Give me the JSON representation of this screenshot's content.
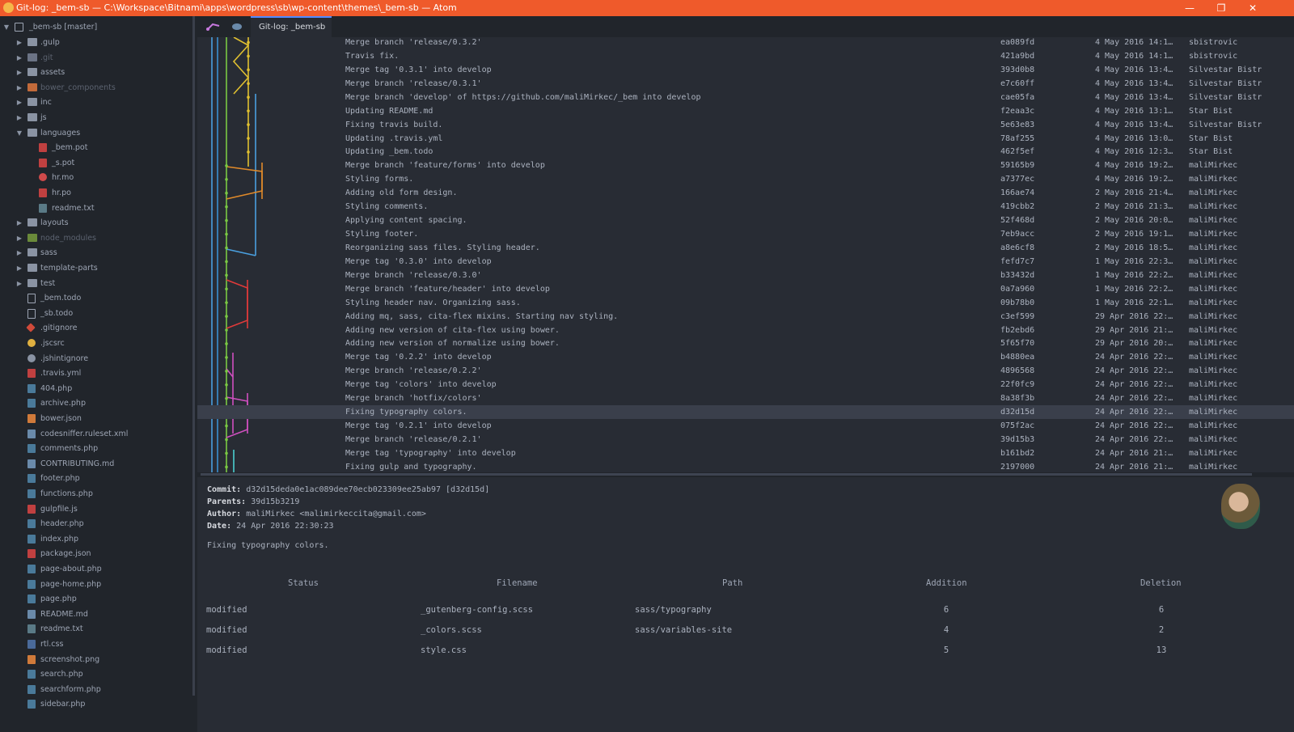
{
  "window": {
    "title": "Git-log: _bem-sb — C:\\Workspace\\Bitnami\\apps\\wordpress\\sb\\wp-content\\themes\\_bem-sb — Atom",
    "min_glyph": "—",
    "max_glyph": "❐",
    "close_glyph": "✕"
  },
  "tree": {
    "root": "_bem-sb [master]",
    "items": [
      {
        "label": ".gulp",
        "type": "folder",
        "depth": 1,
        "expanded": false,
        "color": "#8a93a3"
      },
      {
        "label": ".git",
        "type": "git",
        "depth": 1,
        "expanded": false,
        "color": "#6b7385",
        "dim": true
      },
      {
        "label": "assets",
        "type": "folder",
        "depth": 1,
        "expanded": false,
        "color": "#8a93a3"
      },
      {
        "label": "bower_components",
        "type": "bower",
        "depth": 1,
        "expanded": false,
        "color": "#c26a3a",
        "dim": true
      },
      {
        "label": "inc",
        "type": "folder",
        "depth": 1,
        "expanded": false,
        "color": "#8a93a3"
      },
      {
        "label": "js",
        "type": "folder",
        "depth": 1,
        "expanded": false,
        "color": "#8a93a3"
      },
      {
        "label": "languages",
        "type": "folder",
        "depth": 1,
        "expanded": true,
        "color": "#8a93a3"
      },
      {
        "label": "_bem.pot",
        "type": "file",
        "depth": 2,
        "color": "#c04040"
      },
      {
        "label": "_s.pot",
        "type": "file",
        "depth": 2,
        "color": "#c04040"
      },
      {
        "label": "hr.mo",
        "type": "file",
        "depth": 2,
        "color": "#d04a4a",
        "round": true
      },
      {
        "label": "hr.po",
        "type": "file",
        "depth": 2,
        "color": "#c04040"
      },
      {
        "label": "readme.txt",
        "type": "file",
        "depth": 2,
        "color": "#5a7a86"
      },
      {
        "label": "layouts",
        "type": "folder",
        "depth": 1,
        "expanded": false,
        "color": "#8a93a3"
      },
      {
        "label": "node_modules",
        "type": "node",
        "depth": 1,
        "expanded": false,
        "color": "#6a8a3a",
        "dim": true
      },
      {
        "label": "sass",
        "type": "folder",
        "depth": 1,
        "expanded": false,
        "color": "#8a93a3"
      },
      {
        "label": "template-parts",
        "type": "folder",
        "depth": 1,
        "expanded": false,
        "color": "#8a93a3"
      },
      {
        "label": "test",
        "type": "folder",
        "depth": 1,
        "expanded": false,
        "color": "#8a93a3"
      },
      {
        "label": "_bem.todo",
        "type": "file",
        "depth": 1,
        "color": "#9da5b4",
        "outline": true
      },
      {
        "label": "_sb.todo",
        "type": "file",
        "depth": 1,
        "color": "#9da5b4",
        "outline": true
      },
      {
        "label": ".gitignore",
        "type": "file",
        "depth": 1,
        "color": "#d04a3a",
        "diamond": true
      },
      {
        "label": ".jscsrc",
        "type": "file",
        "depth": 1,
        "color": "#e0b040",
        "gear": true
      },
      {
        "label": ".jshintignore",
        "type": "file",
        "depth": 1,
        "color": "#8a93a3",
        "gear": true
      },
      {
        "label": ".travis.yml",
        "type": "file",
        "depth": 1,
        "color": "#c04040"
      },
      {
        "label": "404.php",
        "type": "file",
        "depth": 1,
        "color": "#4a7a9a"
      },
      {
        "label": "archive.php",
        "type": "file",
        "depth": 1,
        "color": "#4a7a9a"
      },
      {
        "label": "bower.json",
        "type": "file",
        "depth": 1,
        "color": "#d07a3a"
      },
      {
        "label": "codesniffer.ruleset.xml",
        "type": "file",
        "depth": 1,
        "color": "#6a8aaa"
      },
      {
        "label": "comments.php",
        "type": "file",
        "depth": 1,
        "color": "#4a7a9a"
      },
      {
        "label": "CONTRIBUTING.md",
        "type": "file",
        "depth": 1,
        "color": "#6a8aaa"
      },
      {
        "label": "footer.php",
        "type": "file",
        "depth": 1,
        "color": "#4a7a9a"
      },
      {
        "label": "functions.php",
        "type": "file",
        "depth": 1,
        "color": "#4a7a9a"
      },
      {
        "label": "gulpfile.js",
        "type": "file",
        "depth": 1,
        "color": "#c04040"
      },
      {
        "label": "header.php",
        "type": "file",
        "depth": 1,
        "color": "#4a7a9a"
      },
      {
        "label": "index.php",
        "type": "file",
        "depth": 1,
        "color": "#4a7a9a"
      },
      {
        "label": "package.json",
        "type": "file",
        "depth": 1,
        "color": "#c04040"
      },
      {
        "label": "page-about.php",
        "type": "file",
        "depth": 1,
        "color": "#4a7a9a"
      },
      {
        "label": "page-home.php",
        "type": "file",
        "depth": 1,
        "color": "#4a7a9a"
      },
      {
        "label": "page.php",
        "type": "file",
        "depth": 1,
        "color": "#4a7a9a"
      },
      {
        "label": "README.md",
        "type": "file",
        "depth": 1,
        "color": "#6a8aaa"
      },
      {
        "label": "readme.txt",
        "type": "file",
        "depth": 1,
        "color": "#5a7a86"
      },
      {
        "label": "rtl.css",
        "type": "file",
        "depth": 1,
        "color": "#4a6a9a"
      },
      {
        "label": "screenshot.png",
        "type": "file",
        "depth": 1,
        "color": "#d07a3a"
      },
      {
        "label": "search.php",
        "type": "file",
        "depth": 1,
        "color": "#4a7a9a"
      },
      {
        "label": "searchform.php",
        "type": "file",
        "depth": 1,
        "color": "#4a7a9a"
      },
      {
        "label": "sidebar.php",
        "type": "file",
        "depth": 1,
        "color": "#4a7a9a"
      }
    ]
  },
  "tabs": {
    "active_label": "Git-log: _bem-sb"
  },
  "log": {
    "commits": [
      {
        "message": "Merge branch 'release/0.3.2'",
        "hash": "ea089fd",
        "date": "4 May 2016 14:1…",
        "author": "sbistrovic"
      },
      {
        "message": "Travis fix.",
        "hash": "421a9bd",
        "date": "4 May 2016 14:1…",
        "author": "sbistrovic"
      },
      {
        "message": "Merge tag '0.3.1' into develop",
        "hash": "393d0b8",
        "date": "4 May 2016 13:4…",
        "author": "Silvestar Bistr"
      },
      {
        "message": "Merge branch 'release/0.3.1'",
        "hash": "e7c60ff",
        "date": "4 May 2016 13:4…",
        "author": "Silvestar Bistr"
      },
      {
        "message": "Merge branch 'develop' of https://github.com/maliMirkec/_bem into develop",
        "hash": "cae05fa",
        "date": "4 May 2016 13:4…",
        "author": "Silvestar Bistr"
      },
      {
        "message": "Updating README.md",
        "hash": "f2eaa3c",
        "date": "4 May 2016 13:1…",
        "author": "Star Bist"
      },
      {
        "message": "Fixing travis build.",
        "hash": "5e63e83",
        "date": "4 May 2016 13:4…",
        "author": "Silvestar Bistr"
      },
      {
        "message": "Updating .travis.yml",
        "hash": "78af255",
        "date": "4 May 2016 13:0…",
        "author": "Star Bist"
      },
      {
        "message": "Updating _bem.todo",
        "hash": "462f5ef",
        "date": "4 May 2016 12:3…",
        "author": "Star Bist"
      },
      {
        "message": "Merge branch 'feature/forms' into develop",
        "hash": "59165b9",
        "date": "4 May 2016 19:2…",
        "author": "maliMirkec"
      },
      {
        "message": "Styling forms.",
        "hash": "a7377ec",
        "date": "4 May 2016 19:2…",
        "author": "maliMirkec"
      },
      {
        "message": "Adding old form design.",
        "hash": "166ae74",
        "date": "2 May 2016 21:4…",
        "author": "maliMirkec"
      },
      {
        "message": "Styling comments.",
        "hash": "419cbb2",
        "date": "2 May 2016 21:3…",
        "author": "maliMirkec"
      },
      {
        "message": "Applying content spacing.",
        "hash": "52f468d",
        "date": "2 May 2016 20:0…",
        "author": "maliMirkec"
      },
      {
        "message": "Styling footer.",
        "hash": "7eb9acc",
        "date": "2 May 2016 19:1…",
        "author": "maliMirkec"
      },
      {
        "message": "Reorganizing sass files. Styling header.",
        "hash": "a8e6cf8",
        "date": "2 May 2016 18:5…",
        "author": "maliMirkec"
      },
      {
        "message": "Merge tag '0.3.0' into develop",
        "hash": "fefd7c7",
        "date": "1 May 2016 22:3…",
        "author": "maliMirkec"
      },
      {
        "message": "Merge branch 'release/0.3.0'",
        "hash": "b33432d",
        "date": "1 May 2016 22:2…",
        "author": "maliMirkec"
      },
      {
        "message": "Merge branch 'feature/header' into develop",
        "hash": "0a7a960",
        "date": "1 May 2016 22:2…",
        "author": "maliMirkec"
      },
      {
        "message": "Styling header nav. Organizing sass.",
        "hash": "09b78b0",
        "date": "1 May 2016 22:1…",
        "author": "maliMirkec"
      },
      {
        "message": "Adding mq, sass, cita-flex mixins. Starting nav styling.",
        "hash": "c3ef599",
        "date": "29 Apr 2016 22:…",
        "author": "maliMirkec"
      },
      {
        "message": "Adding new version of cita-flex using bower.",
        "hash": "fb2ebd6",
        "date": "29 Apr 2016 21:…",
        "author": "maliMirkec"
      },
      {
        "message": "Adding new version of normalize using bower.",
        "hash": "5f65f70",
        "date": "29 Apr 2016 20:…",
        "author": "maliMirkec"
      },
      {
        "message": "Merge tag '0.2.2' into develop",
        "hash": "b4880ea",
        "date": "24 Apr 2016 22:…",
        "author": "maliMirkec"
      },
      {
        "message": "Merge branch 'release/0.2.2'",
        "hash": "4896568",
        "date": "24 Apr 2016 22:…",
        "author": "maliMirkec"
      },
      {
        "message": "Merge tag 'colors' into develop",
        "hash": "22f0fc9",
        "date": "24 Apr 2016 22:…",
        "author": "maliMirkec"
      },
      {
        "message": "Merge branch 'hotfix/colors'",
        "hash": "8a38f3b",
        "date": "24 Apr 2016 22:…",
        "author": "maliMirkec"
      },
      {
        "message": "Fixing typography colors.",
        "hash": "d32d15d",
        "date": "24 Apr 2016 22:…",
        "author": "maliMirkec",
        "selected": true
      },
      {
        "message": "Merge tag '0.2.1' into develop",
        "hash": "075f2ac",
        "date": "24 Apr 2016 22:…",
        "author": "maliMirkec"
      },
      {
        "message": "Merge branch 'release/0.2.1'",
        "hash": "39d15b3",
        "date": "24 Apr 2016 22:…",
        "author": "maliMirkec"
      },
      {
        "message": "Merge tag 'typography' into develop",
        "hash": "b161bd2",
        "date": "24 Apr 2016 21:…",
        "author": "maliMirkec"
      },
      {
        "message": "Fixing gulp and typography.",
        "hash": "2197000",
        "date": "24 Apr 2016 21:…",
        "author": "maliMirkec"
      }
    ]
  },
  "details": {
    "commit_label": "Commit:",
    "commit_value": "d32d15deda0e1ac089dee70ecb023309ee25ab97 [d32d15d]",
    "parents_label": "Parents:",
    "parents_value": "39d15b3219",
    "author_label": "Author:",
    "author_value": "maliMirkec <malimirkeccita@gmail.com>",
    "date_label": "Date:",
    "date_value": "24 Apr 2016 22:30:23",
    "message": "Fixing typography colors.",
    "file_headers": [
      "Status",
      "Filename",
      "Path",
      "Addition",
      "Deletion"
    ],
    "files": [
      {
        "status": "modified",
        "filename": "_gutenberg-config.scss",
        "path": "sass/typography",
        "addition": "6",
        "deletion": "6"
      },
      {
        "status": "modified",
        "filename": "_colors.scss",
        "path": "sass/variables-site",
        "addition": "4",
        "deletion": "2"
      },
      {
        "status": "modified",
        "filename": "style.css",
        "path": "",
        "addition": "5",
        "deletion": "13"
      }
    ]
  },
  "colors": {
    "titlebar": "#ef5a2b",
    "graph_lanes": [
      "#4aa0e0",
      "#3a8fd0",
      "#7ac943",
      "#e0c030",
      "#e08a2a",
      "#e03a3a",
      "#d050c0",
      "#4ad0d0"
    ]
  }
}
